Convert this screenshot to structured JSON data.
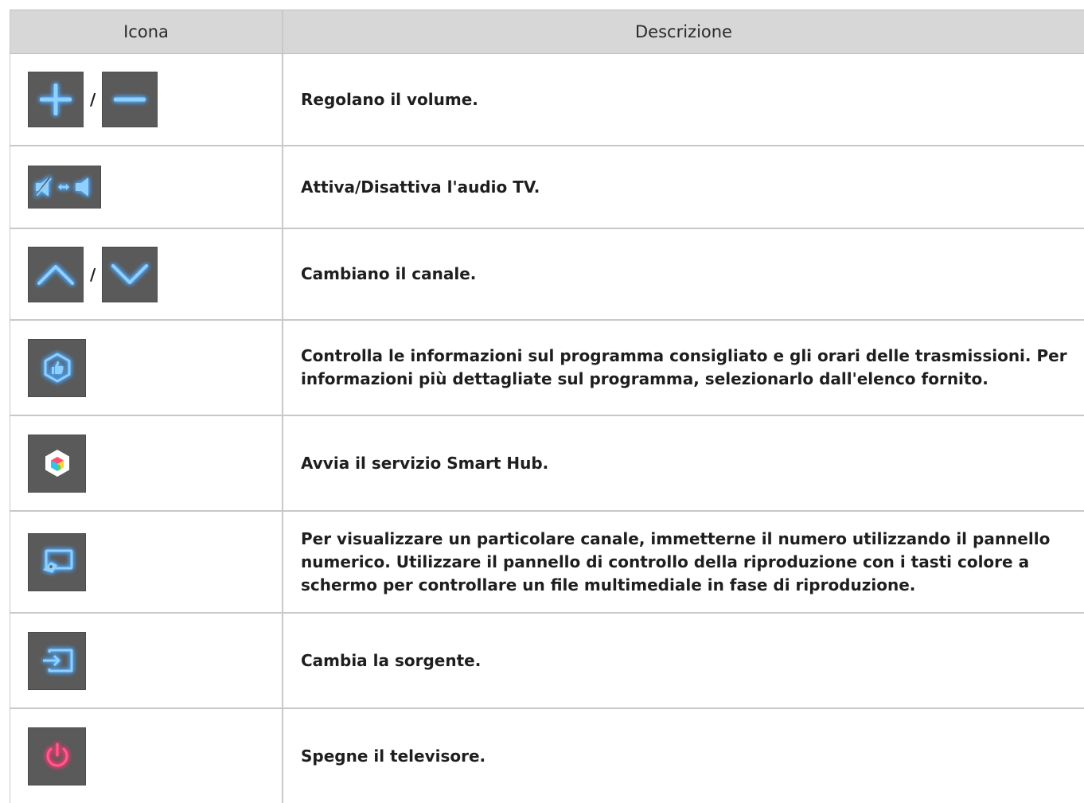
{
  "header": {
    "icon_col": "Icona",
    "desc_col": "Descrizione"
  },
  "rows": [
    {
      "icons": [
        "plus-icon",
        "minus-icon"
      ],
      "separator": "/",
      "description": "Regolano il volume."
    },
    {
      "icons": [
        "mute-toggle-icon"
      ],
      "description": "Attiva/Disattiva l'audio TV."
    },
    {
      "icons": [
        "chevron-up-icon",
        "chevron-down-icon"
      ],
      "separator": "/",
      "description": "Cambiano il canale."
    },
    {
      "icons": [
        "recommended-program-icon"
      ],
      "description": "Controlla le informazioni sul programma consigliato e gli orari delle trasmissioni. Per informazioni più dettagliate sul programma, selezionarlo dall'elenco fornito."
    },
    {
      "icons": [
        "smart-hub-icon"
      ],
      "description": "Avvia il servizio Smart Hub."
    },
    {
      "icons": [
        "numeric-panel-icon"
      ],
      "description": "Per visualizzare un particolare canale, immetterne il numero utilizzando il pannello numerico. Utilizzare il pannello di controllo della riproduzione con i tasti colore a schermo per controllare un file multimediale in fase di riproduzione."
    },
    {
      "icons": [
        "source-icon"
      ],
      "description": "Cambia la sorgente."
    },
    {
      "icons": [
        "power-icon"
      ],
      "description": "Spegne il televisore."
    }
  ],
  "colors": {
    "accent_blue": "#2f8fff",
    "power_red": "#ff2d6f",
    "button_bg": "#5a5a5a",
    "header_bg": "#d7d7d7"
  }
}
